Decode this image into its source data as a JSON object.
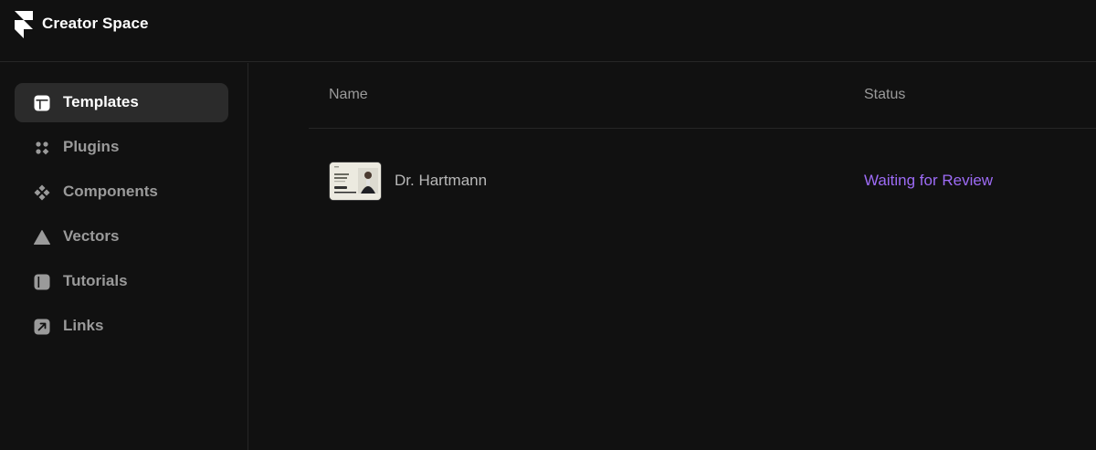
{
  "header": {
    "app_title": "Creator Space",
    "logo_icon": "framer-logo-icon"
  },
  "sidebar": {
    "items": [
      {
        "label": "Templates",
        "icon": "templates-icon",
        "active": true
      },
      {
        "label": "Plugins",
        "icon": "plugins-icon",
        "active": false
      },
      {
        "label": "Components",
        "icon": "components-icon",
        "active": false
      },
      {
        "label": "Vectors",
        "icon": "vectors-icon",
        "active": false
      },
      {
        "label": "Tutorials",
        "icon": "tutorials-icon",
        "active": false
      },
      {
        "label": "Links",
        "icon": "links-icon",
        "active": false
      }
    ]
  },
  "table": {
    "columns": [
      "Name",
      "Status"
    ],
    "rows": [
      {
        "name": "Dr. Hartmann",
        "status": "Waiting for Review"
      }
    ]
  },
  "colors": {
    "background": "#111111",
    "active_item": "#2b2b2b",
    "status_purple": "#9d6bf5",
    "muted_text": "#9a9a9a"
  }
}
